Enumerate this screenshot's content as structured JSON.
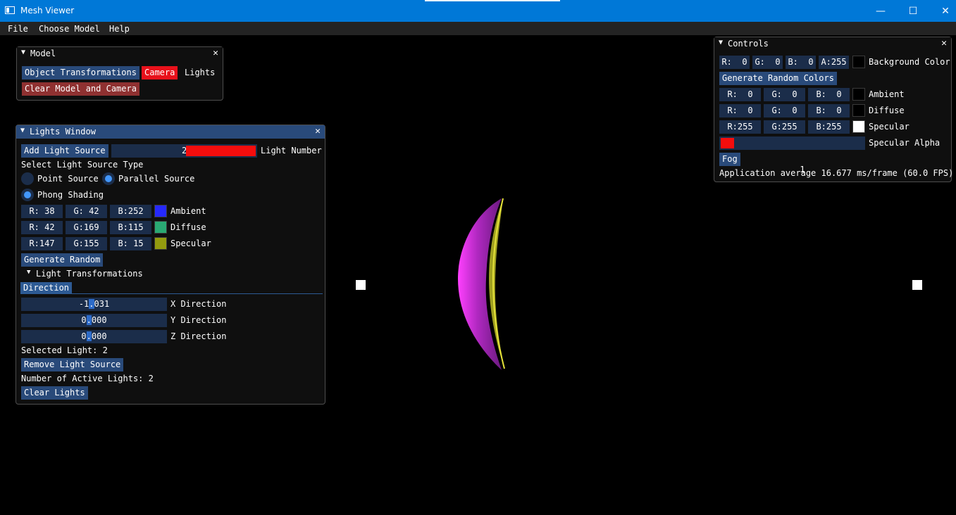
{
  "app": {
    "title": "Mesh Viewer",
    "min": "—",
    "max": "☐",
    "close": "✕"
  },
  "menu": [
    "File",
    "Choose Model",
    "Help"
  ],
  "model_window": {
    "title": "Model",
    "btn_obj": "Object Transformations",
    "btn_camera": "Camera",
    "btn_lights": "Lights",
    "btn_clear": "Clear Model and Camera"
  },
  "lights_window": {
    "title": "Lights Window",
    "add_btn": "Add Light Source",
    "light_number_value": "2",
    "light_number_label": "Light Number",
    "select_type": "Select Light Source Type",
    "point_source": "Point Source",
    "parallel_source": "Parallel Source",
    "phong": "Phong Shading",
    "ambient": {
      "r": "R: 38",
      "g": "G: 42",
      "b": "B:252",
      "label": "Ambient",
      "color": "#2629fc"
    },
    "diffuse": {
      "r": "R: 42",
      "g": "G:169",
      "b": "B:115",
      "label": "Diffuse",
      "color": "#2aa973"
    },
    "specular": {
      "r": "R:147",
      "g": "G:155",
      "b": "B: 15",
      "label": "Specular",
      "color": "#939b0f"
    },
    "gen_random": "Generate Random",
    "light_transformations": "Light Transformations",
    "tab_direction": "Direction",
    "x_val_a": "-1",
    "x_val_b": ".",
    "x_val_c": "031",
    "x_label": "X Direction",
    "y_val_a": "0",
    "y_val_b": ".",
    "y_val_c": "000",
    "y_label": "Y Direction",
    "z_val_a": "0",
    "z_val_b": ".",
    "z_val_c": "000",
    "z_label": "Z Direction",
    "selected_light": "Selected Light: 2",
    "remove_btn": "Remove Light Source",
    "active_lights": "Number of Active Lights: 2",
    "clear_btn": "Clear Lights"
  },
  "controls_window": {
    "title": "Controls",
    "bg": {
      "r": "R:  0",
      "g": "G:  0",
      "b": "B:  0",
      "a": "A:255",
      "label": "Background Color",
      "color": "#000000"
    },
    "gen_random_colors": "Generate Random Colors",
    "ambient": {
      "r": "R:  0",
      "g": "G:  0",
      "b": "B:  0",
      "label": "Ambient",
      "color": "#000000"
    },
    "diffuse": {
      "r": "R:  0",
      "g": "G:  0",
      "b": "B:  0",
      "label": "Diffuse",
      "color": "#000000"
    },
    "specular": {
      "r": "R:255",
      "g": "G:255",
      "b": "B:255",
      "label": "Specular",
      "color": "#ffffff"
    },
    "specular_alpha_value": "1",
    "specular_alpha_label": "Specular Alpha",
    "fog_btn": "Fog",
    "fps": "Application average 16.677 ms/frame (60.0 FPS)"
  }
}
